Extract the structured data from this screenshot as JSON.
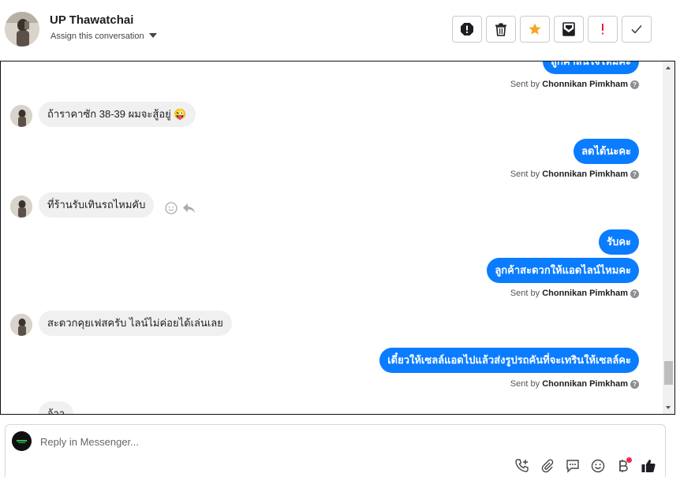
{
  "header": {
    "contact_name": "UP Thawatchai",
    "assign_label": "Assign this conversation",
    "actions": [
      {
        "icon": "alert-octagon-icon",
        "name": "mark-spam-button"
      },
      {
        "icon": "trash-icon",
        "name": "delete-button"
      },
      {
        "icon": "star-icon",
        "name": "star-button"
      },
      {
        "icon": "mark-unread-icon",
        "name": "mark-unread-button"
      },
      {
        "icon": "exclamation-icon",
        "name": "follow-up-button"
      },
      {
        "icon": "check-icon",
        "name": "mark-done-button"
      }
    ]
  },
  "conversation": {
    "top_partial": "ลูกค้าสนใจไหมคะ",
    "sent_by_prefix": "Sent by",
    "sender": "Chonnikan Pimkham",
    "help_glyph": "?",
    "messages": [
      {
        "direction": "in",
        "text": "ถ้าราคาซัก 38-39  ผมจะสู้อยู่ 😜"
      },
      {
        "direction": "out",
        "text": "ลดได้นะคะ"
      },
      {
        "direction": "in",
        "text": "ที่ร้านรับเทินรถไหมคับ"
      },
      {
        "direction": "out",
        "text": "รับคะ"
      },
      {
        "direction": "out",
        "text": "ลูกค้าสะดวกให้แอดไลน์ไหมคะ"
      },
      {
        "direction": "in",
        "text": "สะดวกคุยเฟสครับ ไลน์ไม่ค่อยได้เล่นเลย"
      },
      {
        "direction": "out",
        "text": "เดี๋ยวให้เซลล์แอดไปแล้วส่งรูปรถคันที่จะเทรินให้เซลล์คะ"
      },
      {
        "direction": "in",
        "text": "จ้าา"
      }
    ]
  },
  "composer": {
    "placeholder": "Reply in Messenger...",
    "tools": [
      "phone-add-icon",
      "paperclip-icon",
      "saved-reply-icon",
      "emoji-icon",
      "baht-payment-icon",
      "thumbs-up-icon"
    ]
  },
  "colors": {
    "outgoing_bubble": "#0a7cff",
    "incoming_bubble": "#f0f0f0",
    "star": "#f5a623",
    "alert": "#e41e3f"
  }
}
